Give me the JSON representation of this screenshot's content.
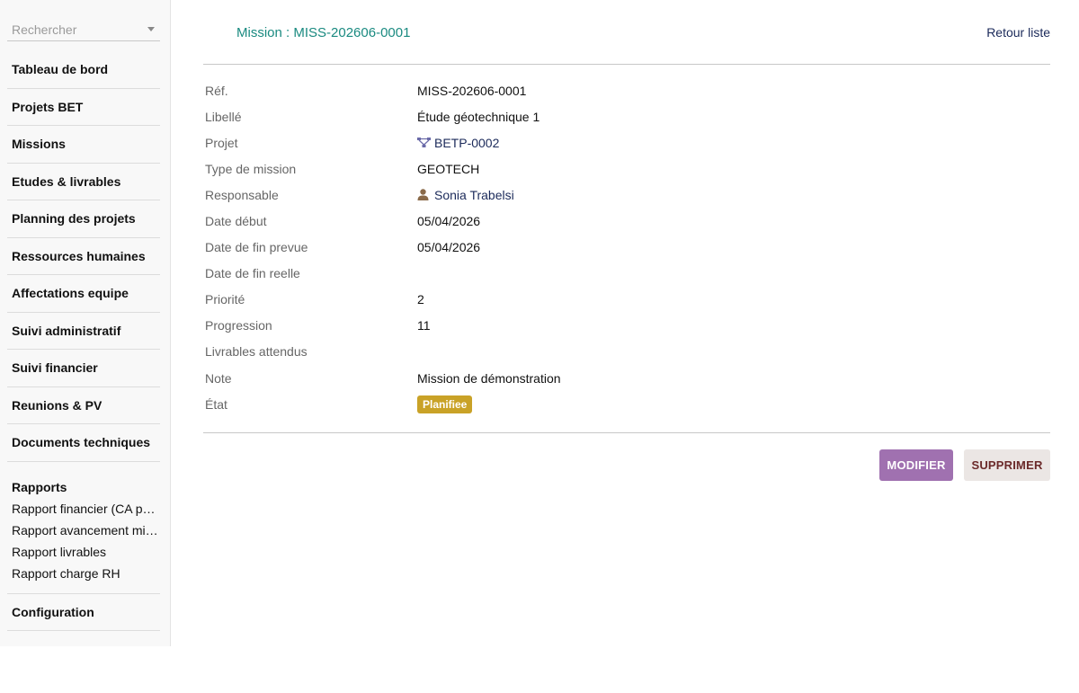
{
  "sidebar": {
    "search_placeholder": "Rechercher",
    "items": [
      {
        "label": "Tableau de bord"
      },
      {
        "label": "Projets BET"
      },
      {
        "label": "Missions"
      },
      {
        "label": "Etudes & livrables"
      },
      {
        "label": "Planning des projets"
      },
      {
        "label": "Ressources humaines"
      },
      {
        "label": "Affectations equipe"
      },
      {
        "label": "Suivi administratif"
      },
      {
        "label": "Suivi financier"
      },
      {
        "label": "Reunions & PV"
      },
      {
        "label": "Documents techniques"
      }
    ],
    "rapports": {
      "title": "Rapports",
      "items": [
        {
          "label": "Rapport financier (CA par projet)"
        },
        {
          "label": "Rapport avancement missions"
        },
        {
          "label": "Rapport livrables"
        },
        {
          "label": "Rapport charge RH"
        }
      ]
    },
    "configuration": "Configuration"
  },
  "header": {
    "title": "Mission : MISS-202606-0001",
    "back_label": "Retour liste"
  },
  "fields": [
    {
      "label": "Réf.",
      "value": "MISS-202606-0001"
    },
    {
      "label": "Libellé",
      "value": "Étude géotechnique 1"
    },
    {
      "label": "Projet",
      "value": "BETP-0002",
      "icon": "project-tree-icon"
    },
    {
      "label": "Type de mission",
      "value": "GEOTECH"
    },
    {
      "label": "Responsable",
      "value": "Sonia Trabelsi",
      "icon": "user-icon"
    },
    {
      "label": "Date début",
      "value": "05/04/2026"
    },
    {
      "label": "Date de fin prevue",
      "value": "05/04/2026"
    },
    {
      "label": "Date de fin reelle",
      "value": ""
    },
    {
      "label": "Priorité",
      "value": "2"
    },
    {
      "label": "Progression",
      "value": "11"
    },
    {
      "label": "Livrables attendus",
      "value": ""
    },
    {
      "label": "Note",
      "value": "Mission de démonstration"
    },
    {
      "label": "État",
      "value": "Planifiee",
      "badge_color": "#c9a227"
    }
  ],
  "actions": {
    "edit_label": "MODIFIER",
    "delete_label": "SUPPRIMER"
  },
  "colors": {
    "title": "#1a8a80",
    "link": "#1b2a5a",
    "edit_button": "#a071b0",
    "delete_button_bg": "#ebe6e4",
    "delete_button_text": "#6b2a2a"
  }
}
